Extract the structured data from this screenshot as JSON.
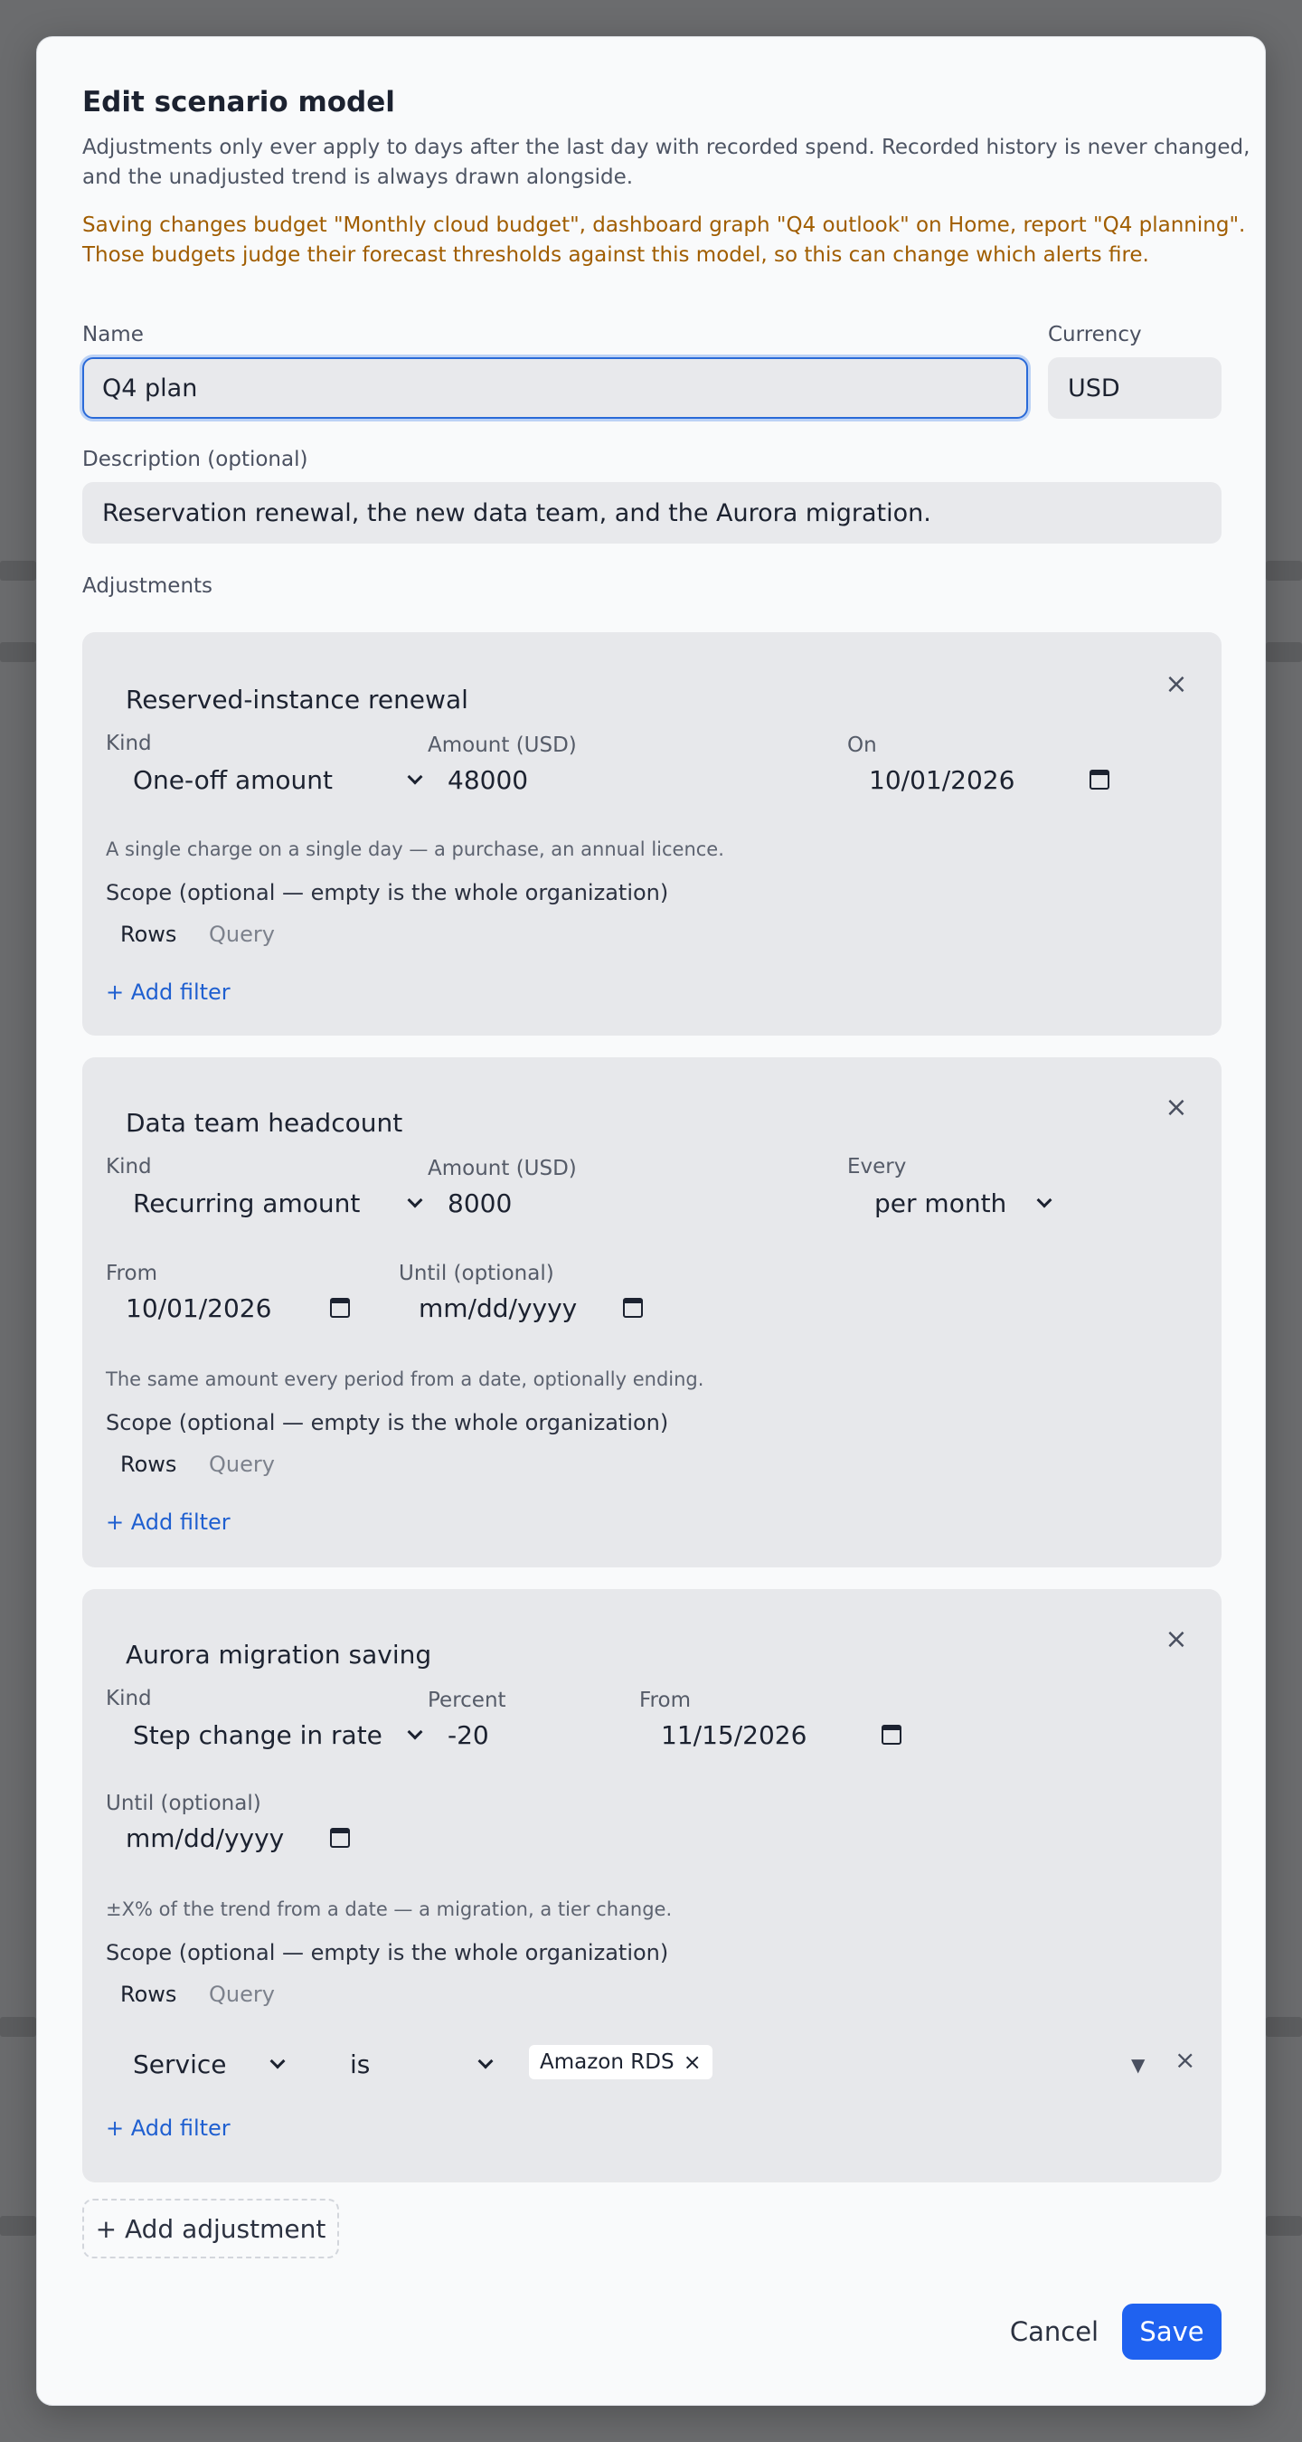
{
  "modal": {
    "title": "Edit scenario model",
    "subtitle": "Adjustments only ever apply to days after the last day with recorded spend. Recorded history is never changed, and the unadjusted trend is always drawn alongside.",
    "warning": "Saving changes budget \"Monthly cloud budget\", dashboard graph \"Q4 outlook\" on Home, report \"Q4 planning\". Those budgets judge their forecast thresholds against this model, so this can change which alerts fire.",
    "name_label": "Name",
    "name_value": "Q4 plan",
    "currency_label": "Currency",
    "currency_value": "USD",
    "description_label": "Description (optional)",
    "description_value": "Reservation renewal, the new data team, and the Aurora migration.",
    "adjustments_label": "Adjustments",
    "add_adjustment": "+ Add adjustment",
    "cancel": "Cancel",
    "save": "Save"
  },
  "adjustments": [
    {
      "title": "Reserved-instance renewal",
      "kind_label": "Kind",
      "kind_value": "One-off amount",
      "amount_label": "Amount (USD)",
      "amount_value": "48000",
      "on_label": "On",
      "on_value": "10/01/2026",
      "hint": "A single charge on a single day — a purchase, an annual licence.",
      "scope_label": "Scope (optional — empty is the whole organization)",
      "tab_rows": "Rows",
      "tab_query": "Query",
      "add_filter": "+ Add filter"
    },
    {
      "title": "Data team headcount",
      "kind_label": "Kind",
      "kind_value": "Recurring amount",
      "amount_label": "Amount (USD)",
      "amount_value": "8000",
      "every_label": "Every",
      "every_value": "per month",
      "from_label": "From",
      "from_value": "10/01/2026",
      "until_label": "Until (optional)",
      "until_value": "mm/dd/yyyy",
      "hint": "The same amount every period from a date, optionally ending.",
      "scope_label": "Scope (optional — empty is the whole organization)",
      "tab_rows": "Rows",
      "tab_query": "Query",
      "add_filter": "+ Add filter"
    },
    {
      "title": "Aurora migration saving",
      "kind_label": "Kind",
      "kind_value": "Step change in rate",
      "percent_label": "Percent",
      "percent_value": "-20",
      "from_label": "From",
      "from_value": "11/15/2026",
      "until_label": "Until (optional)",
      "until_value": "mm/dd/yyyy",
      "hint": "±X% of the trend from a date — a migration, a tier change.",
      "scope_label": "Scope (optional — empty is the whole organization)",
      "tab_rows": "Rows",
      "tab_query": "Query",
      "filter_field": "Service",
      "filter_op": "is",
      "filter_chip": "Amazon RDS",
      "add_filter": "+ Add filter"
    }
  ]
}
